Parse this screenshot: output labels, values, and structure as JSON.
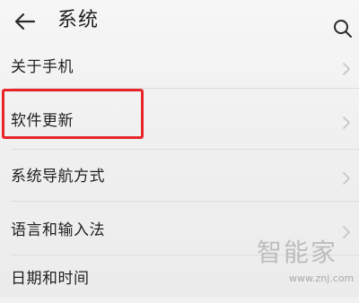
{
  "header": {
    "title": "系统",
    "back_icon": "arrow-left-icon",
    "search_icon": "search-icon"
  },
  "settings_items": [
    {
      "label": "关于手机",
      "icon": "chevron-right-icon"
    },
    {
      "label": "软件更新",
      "icon": "chevron-right-icon",
      "highlighted": true
    },
    {
      "label": "系统导航方式",
      "icon": "chevron-right-icon"
    },
    {
      "label": "语言和输入法",
      "icon": "chevron-right-icon"
    },
    {
      "label": "日期和时间",
      "icon": "chevron-right-icon"
    }
  ],
  "highlight": {
    "color": "#e8262a"
  },
  "watermark": {
    "text": "智能家",
    "url": "www.znj.com"
  }
}
